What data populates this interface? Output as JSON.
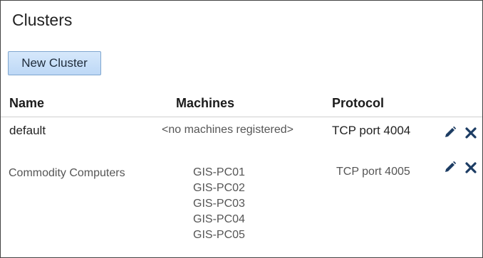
{
  "page": {
    "title": "Clusters"
  },
  "toolbar": {
    "new_cluster_label": "New Cluster"
  },
  "table": {
    "headers": {
      "name": "Name",
      "machines": "Machines",
      "protocol": "Protocol"
    },
    "rows": [
      {
        "name": "default",
        "machines_empty": "<no machines registered>",
        "machines": [],
        "protocol": "TCP port 4004",
        "actions": [
          "pencil-icon",
          "close-icon"
        ]
      },
      {
        "name": "Commodity Computers",
        "machines": [
          "GIS-PC01",
          "GIS-PC02",
          "GIS-PC03",
          "GIS-PC04",
          "GIS-PC05"
        ],
        "protocol": "TCP port 4005",
        "actions": [
          "pencil-icon",
          "close-icon"
        ]
      }
    ]
  },
  "colors": {
    "button_bg": "#c6ddf7",
    "button_border": "#7fa6cf",
    "icon": "#1c3c63",
    "divider": "#cfcfcf"
  }
}
